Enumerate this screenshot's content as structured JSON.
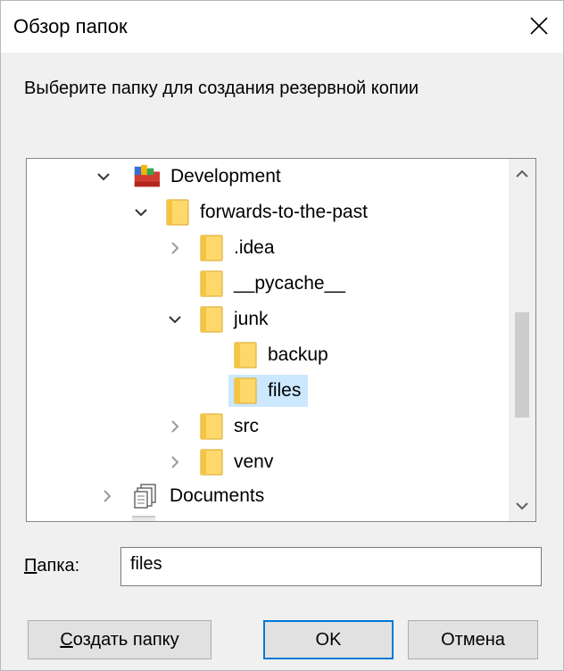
{
  "window": {
    "title": "Обзор папок",
    "close_icon": "close-icon"
  },
  "prompt": "Выберите папку для создания резервной копии",
  "tree": {
    "items": [
      {
        "label": "Development",
        "icon": "development-folder-icon",
        "expanded": true,
        "depth": 0
      },
      {
        "label": "forwards-to-the-past",
        "icon": "folder-icon",
        "expanded": true,
        "depth": 1
      },
      {
        "label": ".idea",
        "icon": "folder-icon",
        "expanded": false,
        "depth": 2
      },
      {
        "label": "__pycache__",
        "icon": "folder-icon",
        "depth": 2
      },
      {
        "label": "junk",
        "icon": "folder-icon",
        "expanded": true,
        "depth": 2
      },
      {
        "label": "backup",
        "icon": "folder-icon",
        "depth": 3
      },
      {
        "label": "files",
        "icon": "folder-icon",
        "selected": true,
        "depth": 3
      },
      {
        "label": "src",
        "icon": "folder-icon",
        "expanded": false,
        "depth": 2
      },
      {
        "label": "venv",
        "icon": "folder-icon",
        "expanded": false,
        "depth": 2
      },
      {
        "label": "Documents",
        "icon": "documents-icon",
        "expanded": false,
        "depth": 0
      }
    ]
  },
  "folder_field": {
    "label_mnemonic": "П",
    "label_rest": "апка:",
    "value": "files"
  },
  "buttons": {
    "new_folder_mnemonic": "С",
    "new_folder_rest": "оздать папку",
    "ok": "OK",
    "cancel": "Отмена"
  },
  "colors": {
    "selection": "#cce8ff",
    "default_button_border": "#0078d7",
    "folder": "#ffd86b"
  }
}
